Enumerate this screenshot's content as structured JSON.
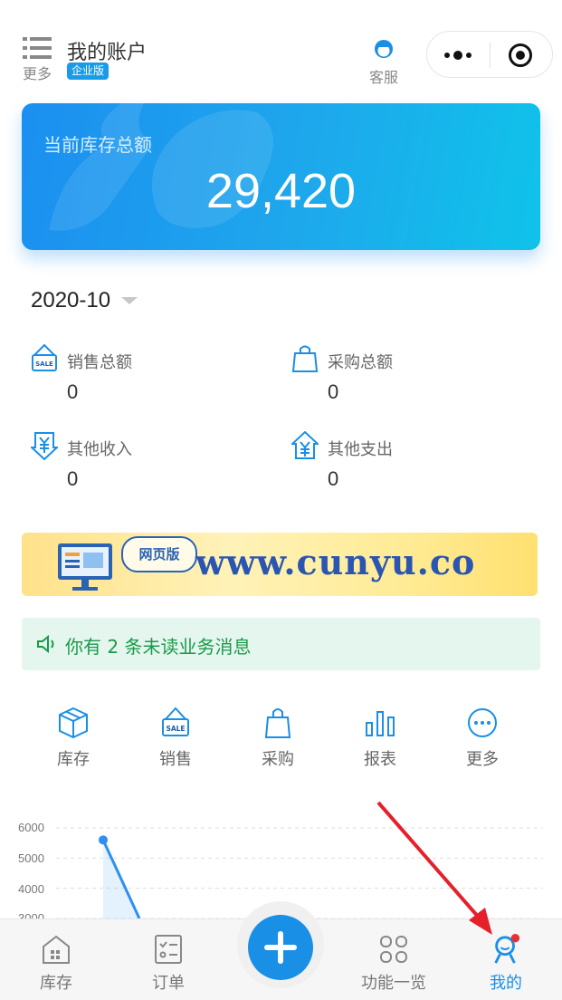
{
  "header": {
    "menu_label": "更多",
    "title": "我的账户",
    "edition_badge": "企业版",
    "service_label": "客服"
  },
  "stock": {
    "label": "当前库存总额",
    "value": "29,420"
  },
  "period": "2020-10",
  "stats": [
    {
      "label": "销售总额",
      "value": "0",
      "icon": "sale-tag-icon"
    },
    {
      "label": "采购总额",
      "value": "0",
      "icon": "shopping-bag-icon"
    },
    {
      "label": "其他收入",
      "value": "0",
      "icon": "yuan-in-icon"
    },
    {
      "label": "其他支出",
      "value": "0",
      "icon": "yuan-out-icon"
    }
  ],
  "promo": {
    "tag": "网页版",
    "url": "www.cunyu.co"
  },
  "notice": {
    "message": "你有 2 条未读业务消息",
    "color": "#1a9a4a"
  },
  "functions": [
    {
      "label": "库存",
      "icon": "box-icon"
    },
    {
      "label": "销售",
      "icon": "sale-tag-icon"
    },
    {
      "label": "采购",
      "icon": "shopping-bag-icon"
    },
    {
      "label": "报表",
      "icon": "bar-chart-icon"
    },
    {
      "label": "更多",
      "icon": "more-circle-icon"
    }
  ],
  "chart_data": {
    "type": "line",
    "yticks": [
      "6000",
      "5000",
      "4000",
      "3000"
    ],
    "ylim": [
      3000,
      6000
    ],
    "series": [
      {
        "x": [
          0,
          1
        ],
        "values": [
          5600,
          3000
        ]
      }
    ]
  },
  "tabbar": {
    "items": [
      {
        "label": "库存",
        "icon": "warehouse-icon",
        "active": false
      },
      {
        "label": "订单",
        "icon": "order-list-icon",
        "active": false
      },
      {
        "label": "功能一览",
        "icon": "grid-icon",
        "active": false
      },
      {
        "label": "我的",
        "icon": "user-icon",
        "active": true
      }
    ],
    "add_icon": "plus-icon"
  },
  "colors": {
    "accent": "#1a8fe6",
    "badge_dot": "#e8303a",
    "arrow": "#e5202a"
  }
}
